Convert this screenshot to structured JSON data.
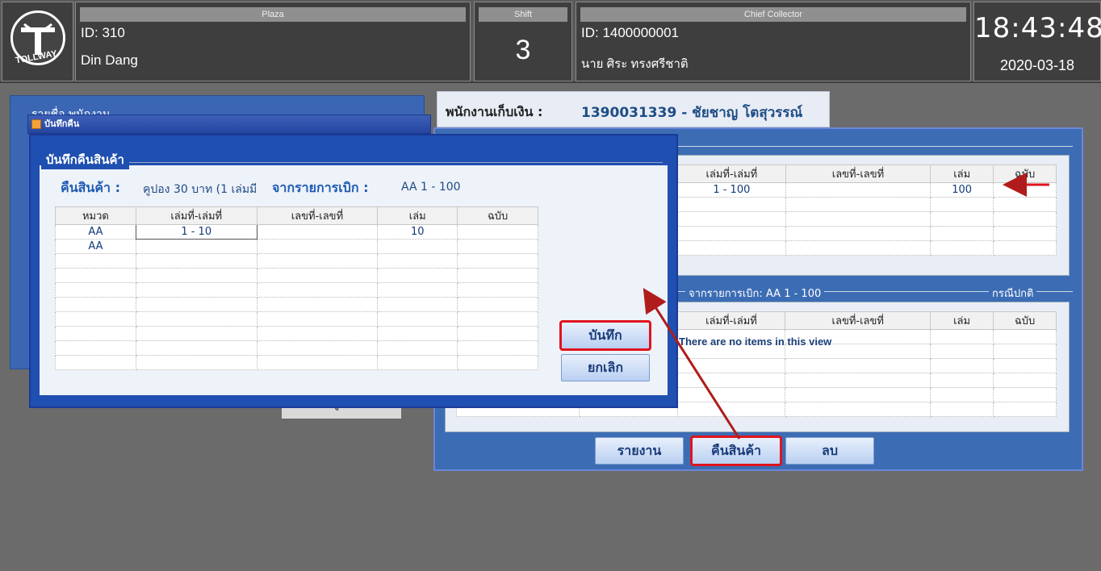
{
  "header": {
    "logo_text": "TOLLWAY",
    "plaza": {
      "caption": "Plaza",
      "id": "ID: 310",
      "name": "Din Dang"
    },
    "shift": {
      "caption": "Shift",
      "value": "3"
    },
    "chief": {
      "caption": "Chief Collector",
      "id": "ID: 1400000001",
      "name": "นาย ศิระ ทรงศรีชาติ"
    },
    "clock": {
      "time": "18:43:48",
      "date": "2020-03-18"
    }
  },
  "list_window": {
    "title": "รายชื่อ พนักงาน"
  },
  "small_window": {
    "title": "บันทึกคืน"
  },
  "return_coupon_button": "คืนคูปอง",
  "collector": {
    "label": "พนักงานเก็บเงิน :",
    "value": "1390031339 - ชัยชาญ โตสุวรรณ์"
  },
  "main_window": {
    "top_table": {
      "columns": [
        "เล่มที่-เล่มที่",
        "เลขที่-เลขที่",
        "เล่ม",
        "ฉบับ"
      ],
      "rows": [
        [
          "1 - 100",
          "",
          "100",
          ""
        ]
      ]
    },
    "section_legend": "จากรายการเบิก: AA  1 - 100",
    "section_legend_right": "กรณีปกติ",
    "bottom_table": {
      "columns": [
        "เล่มที่-เล่มที่",
        "เลขที่-เลขที่",
        "เล่ม",
        "ฉบับ"
      ],
      "empty_message": "There are no items in this view"
    },
    "buttons": {
      "report": "รายงาน",
      "return": "คืนสินค้า",
      "delete": "ลบ"
    }
  },
  "dialog": {
    "group_title": "บันทึกคืนสินค้า",
    "return_label": "คืนสินค้า :",
    "return_value": "คูปอง 30 บาท (1 เล่มมี",
    "from_label": "จากรายการเบิก :",
    "from_value": "AA 1 - 100",
    "table": {
      "columns": [
        "หมวด",
        "เล่มที่-เล่มที่",
        "เลขที่-เลขที่",
        "เล่ม",
        "ฉบับ"
      ],
      "rows": [
        [
          "AA",
          "1 - 10",
          "",
          "10",
          ""
        ],
        [
          "AA",
          "",
          "",
          "",
          ""
        ]
      ]
    },
    "save": "บันทึก",
    "cancel": "ยกเลิก"
  },
  "colors": {
    "accent": "#3c6db4",
    "highlight": "#e0141d",
    "arrow": "#b01c1c"
  }
}
